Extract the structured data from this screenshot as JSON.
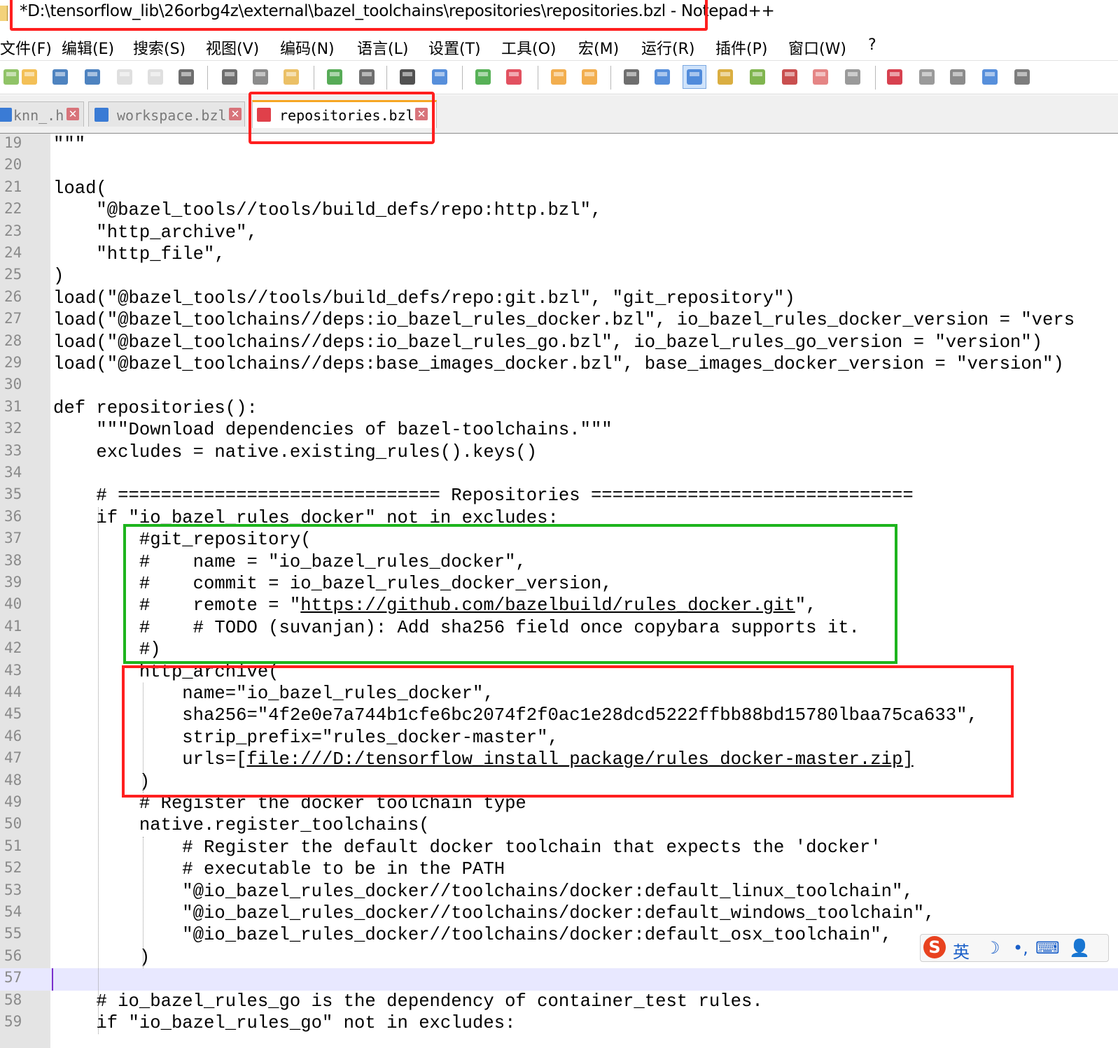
{
  "window": {
    "title": "*D:\\tensorflow_lib\\26orbg4z\\external\\bazel_toolchains\\repositories\\repositories.bzl - Notepad++"
  },
  "menu": [
    "文件(F)",
    "编辑(E)",
    "搜索(S)",
    "视图(V)",
    "编码(N)",
    "语言(L)",
    "设置(T)",
    "工具(O)",
    "宏(M)",
    "运行(R)",
    "插件(P)",
    "窗口(W)",
    "?"
  ],
  "toolbar": {
    "buttons": [
      "new-file",
      "open-file",
      "save",
      "save-all",
      "close",
      "close-all",
      "print",
      "cut",
      "copy",
      "paste",
      "undo",
      "redo",
      "find",
      "replace",
      "zoom-in",
      "zoom-out",
      "sync-v",
      "sync-h",
      "word-wrap",
      "show-all-chars",
      "indent-guide",
      "udl",
      "doc-map",
      "function-list",
      "folder-workspace",
      "monitor",
      "record-macro",
      "stop-macro",
      "play-macro",
      "run-macro-multiple",
      "save-macro"
    ]
  },
  "tabs": [
    {
      "label": "knn_.h",
      "active": false,
      "color": "#3a7bd5"
    },
    {
      "label": "workspace.bzl",
      "active": false,
      "color": "#3a7bd5"
    },
    {
      "label": "repositories.bzl",
      "active": true,
      "color": "#e0404a"
    }
  ],
  "editor": {
    "lines": [
      {
        "n": "19",
        "text": "\"\"\""
      },
      {
        "n": "20",
        "text": ""
      },
      {
        "n": "21",
        "text": "load("
      },
      {
        "n": "22",
        "text": "    \"@bazel_tools//tools/build_defs/repo:http.bzl\","
      },
      {
        "n": "23",
        "text": "    \"http_archive\","
      },
      {
        "n": "24",
        "text": "    \"http_file\","
      },
      {
        "n": "25",
        "text": ")"
      },
      {
        "n": "26",
        "text": "load(\"@bazel_tools//tools/build_defs/repo:git.bzl\", \"git_repository\")"
      },
      {
        "n": "27",
        "text": "load(\"@bazel_toolchains//deps:io_bazel_rules_docker.bzl\", io_bazel_rules_docker_version = \"vers"
      },
      {
        "n": "28",
        "text": "load(\"@bazel_toolchains//deps:io_bazel_rules_go.bzl\", io_bazel_rules_go_version = \"version\")"
      },
      {
        "n": "29",
        "text": "load(\"@bazel_toolchains//deps:base_images_docker.bzl\", base_images_docker_version = \"version\")"
      },
      {
        "n": "30",
        "text": ""
      },
      {
        "n": "31",
        "text": "def repositories():"
      },
      {
        "n": "32",
        "text": "    \"\"\"Download dependencies of bazel-toolchains.\"\"\""
      },
      {
        "n": "33",
        "text": "    excludes = native.existing_rules().keys()"
      },
      {
        "n": "34",
        "text": ""
      },
      {
        "n": "35",
        "text": "    # ============================== Repositories =============================="
      },
      {
        "n": "36",
        "text": "    if \"io_bazel_rules_docker\" not in excludes:"
      },
      {
        "n": "37",
        "text": "        #git_repository("
      },
      {
        "n": "38",
        "text": "        #    name = \"io_bazel_rules_docker\","
      },
      {
        "n": "39",
        "text": "        #    commit = io_bazel_rules_docker_version,"
      },
      {
        "n": "40",
        "pre": "        #    remote = \"",
        "url": "https://github.com/bazelbuild/rules_docker.git",
        "post": "\","
      },
      {
        "n": "41",
        "text": "        #    # TODO (suvanjan): Add sha256 field once copybara supports it."
      },
      {
        "n": "42",
        "text": "        #)"
      },
      {
        "n": "43",
        "text": "        http_archive("
      },
      {
        "n": "44",
        "text": "            name=\"io_bazel_rules_docker\","
      },
      {
        "n": "45",
        "text": "            sha256=\"4f2e0e7a744b1cfe6bc2074f2f0ac1e28dcd5222ffbb88bd15780lbaa75ca633\","
      },
      {
        "n": "46",
        "text": "            strip_prefix=\"rules_docker-master\","
      },
      {
        "n": "47",
        "pre": "            urls=[",
        "url": "file:///D:/tensorflow_install_package/rules_docker-master.zip]",
        "post": ""
      },
      {
        "n": "48",
        "text": "        )"
      },
      {
        "n": "49",
        "text": "        # Register the docker toolchain type"
      },
      {
        "n": "50",
        "text": "        native.register_toolchains("
      },
      {
        "n": "51",
        "text": "            # Register the default docker toolchain that expects the 'docker'"
      },
      {
        "n": "52",
        "text": "            # executable to be in the PATH"
      },
      {
        "n": "53",
        "text": "            \"@io_bazel_rules_docker//toolchains/docker:default_linux_toolchain\","
      },
      {
        "n": "54",
        "text": "            \"@io_bazel_rules_docker//toolchains/docker:default_windows_toolchain\","
      },
      {
        "n": "55",
        "text": "            \"@io_bazel_rules_docker//toolchains/docker:default_osx_toolchain\","
      },
      {
        "n": "56",
        "text": "        )"
      },
      {
        "n": "57",
        "text": "",
        "current": true
      },
      {
        "n": "58",
        "text": "    # io_bazel_rules_go is the dependency of container_test rules."
      },
      {
        "n": "59",
        "text": "    if \"io_bazel_rules_go\" not in excludes:"
      }
    ]
  },
  "ime": {
    "logo": "S",
    "lang": "英",
    "moon": "☽",
    "punct": "•,",
    "keyboard": "⌨",
    "user": "👤"
  },
  "colors": {
    "annotation_red": "#ff1f1f",
    "annotation_green": "#1db41d",
    "current_line": "#e8e8ff",
    "gutter": "#e4e4e4"
  }
}
